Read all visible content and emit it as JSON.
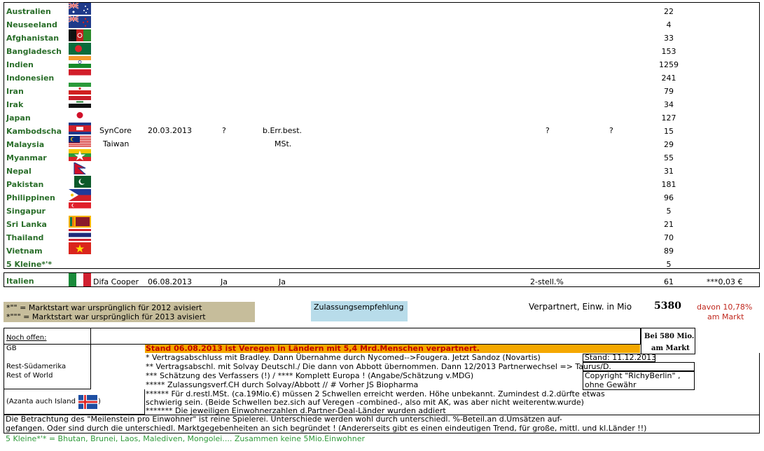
{
  "countries": [
    {
      "name": "Australien",
      "value": "22",
      "flag": "australia-flag"
    },
    {
      "name": "Neuseeland",
      "value": "4",
      "flag": "new-zealand-flag"
    },
    {
      "name": "Afghanistan",
      "value": "33",
      "flag": "afghanistan-flag"
    },
    {
      "name": "Bangladesch",
      "value": "153",
      "flag": "bangladesh-flag"
    },
    {
      "name": "Indien",
      "value": "1259",
      "flag": "india-flag"
    },
    {
      "name": "Indonesien",
      "value": "241",
      "flag": "indonesia-flag"
    },
    {
      "name": "Iran",
      "value": "79",
      "flag": "iran-flag"
    },
    {
      "name": "Irak",
      "value": "34",
      "flag": "iraq-flag"
    },
    {
      "name": "Japan",
      "value": "127",
      "flag": "japan-flag"
    },
    {
      "name": "Kambodscha",
      "value": "15",
      "flag": "cambodia-flag"
    },
    {
      "name": "Malaysia",
      "value": "29",
      "flag": "malaysia-flag"
    },
    {
      "name": "Myanmar",
      "value": "55",
      "flag": "myanmar-flag"
    },
    {
      "name": "Nepal",
      "value": "31",
      "flag": "nepal-flag"
    },
    {
      "name": "Pakistan",
      "value": "181",
      "flag": "pakistan-flag"
    },
    {
      "name": "Philippinen",
      "value": "96",
      "flag": "philippines-flag"
    },
    {
      "name": "Singapur",
      "value": "5",
      "flag": "singapore-flag"
    },
    {
      "name": "Sri Lanka",
      "value": "21",
      "flag": "sri-lanka-flag"
    },
    {
      "name": "Thailand",
      "value": "70",
      "flag": "thailand-flag"
    },
    {
      "name": "Vietnam",
      "value": "89",
      "flag": "vietnam-flag"
    },
    {
      "name": "5 Kleine*'*",
      "value": "5",
      "flag": ""
    }
  ],
  "kambodscha_row": {
    "partner": "SynCore",
    "date": "20.03.2013",
    "q1": "?",
    "status": "b.Err.best.",
    "q2": "?",
    "q3": "?"
  },
  "malaysia_row": {
    "partner": "Taiwan",
    "status": "MSt."
  },
  "italien": {
    "name": "Italien",
    "partner": "Difa Cooper",
    "date": "06.08.2013",
    "c1": "Ja",
    "c2": "Ja",
    "note": "2-stell.%",
    "value": "61",
    "extra": "***0,03 €",
    "flag": "italy-flag"
  },
  "legend": {
    "line1": "*\"\"  = Marktstart war ursprünglich für 2012 avisiert",
    "line2": "*\"\"\" = Marktstart war ursprünglich für 2013 avisiert",
    "recommendation": "Zulassungsempfehlung"
  },
  "summary": {
    "label": "Verpartnert,  Einw. in Mio",
    "total": "5380",
    "share_line1": "davon 10,78%",
    "share_line2": "am Markt"
  },
  "open": {
    "title": "Noch offen:",
    "items": [
      "GB",
      "Rest-Südamerika",
      "Rest of World"
    ],
    "iceland": "(Azanta auch Island",
    "iceland_close": ")",
    "iceland_flag": "iceland-flag"
  },
  "market": {
    "line1": "Bei 580 Mio.",
    "line2": "am Markt"
  },
  "headline": "Stand 06.08.2013 ist Veregen in Ländern mit 5,4 Mrd.Menschen verpartnert.",
  "notes": [
    "* Vertragsabschluss mit Bradley. Dann Übernahme durch Nycomed-->Fougera. Jetzt Sandoz (Novartis)",
    "** Vertragsabschl. mit Solvay Deutschl./ Die dann von Abbott übernommen. Dann 12/2013 Partnerwechsel => Taurus/D.",
    "*** Schätzung des Verfassers (!)   /     **** Komplett Europa ! (Angabe/Schätzung v.MDG)",
    "***** Zulassungsverf.CH durch Solvay/Abbott           //      # Vorher JS Biopharma",
    "****** Für d.restl.MSt. (ca.19Mio.€) müssen 2 Schwellen erreicht werden. Höhe unbekannt. Zumindest d.2.dürfte etwas",
    "schwierig sein. (Beide Schwellen bez.sich auf Veregen -combined-, also mit AK, was aber nicht weiterentw.wurde)",
    "******* Die jeweiligen Einwohnerzahlen d.Partner-Deal-Länder wurden addiert"
  ],
  "stand_box": "Stand: 11.12.2013",
  "copyright_line1": "Copyright \"RichyBerlin\" ,",
  "copyright_line2": " ohne Gewähr",
  "bottom_text_line1": "Die Betrachtung des \"Meilenstein pro Einwohner\" ist reine Spielerei. Unterschiede werden wohl durch unterschiedl. %-Beteil.an d.Umsätzen auf-",
  "bottom_text_line2": "gefangen. Oder sind durch die unterschiedl. Marktgegebenheiten an sich begründet ! (Andererseits gibt es einen eindeutigen Trend, für große, mittl. und kl.Länder !!)",
  "footnote": "5 Kleine*'* = Bhutan, Brunei, Laos, Malediven, Mongolei.... Zusammen keine 5Mio.Einwohner",
  "colors": {
    "country_green": "#2a6e2a",
    "headline_bg": "#f5a800",
    "headline_text": "#c00000",
    "legend_bg": "#c6bd9b",
    "recommend_bg": "#b8dcea",
    "footnote_green": "#2f9a3a",
    "share_red": "#c0281e"
  }
}
